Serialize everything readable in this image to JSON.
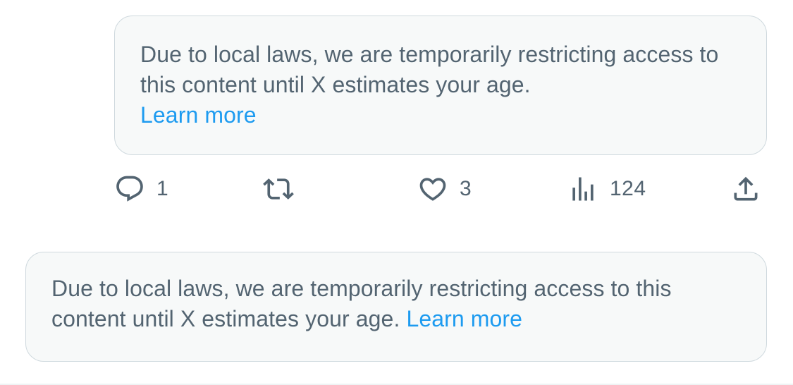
{
  "notices": [
    {
      "message": "Due to local laws, we are temporarily restricting access to this content until X estimates your age.",
      "link_label": "Learn more"
    },
    {
      "message": "Due to local laws, we are temporarily restricting access to this content until X estimates your age.",
      "link_label": "Learn more"
    }
  ],
  "actions": {
    "reply": {
      "icon": "reply-icon",
      "count": "1"
    },
    "repost": {
      "icon": "repost-icon",
      "count": ""
    },
    "like": {
      "icon": "like-icon",
      "count": "3"
    },
    "views": {
      "icon": "views-icon",
      "count": "124"
    },
    "share": {
      "icon": "share-icon"
    }
  },
  "colors": {
    "text_secondary": "#536471",
    "link": "#1d9bf0",
    "notice_background": "#f7f9f9",
    "notice_border": "#cfd9de"
  }
}
